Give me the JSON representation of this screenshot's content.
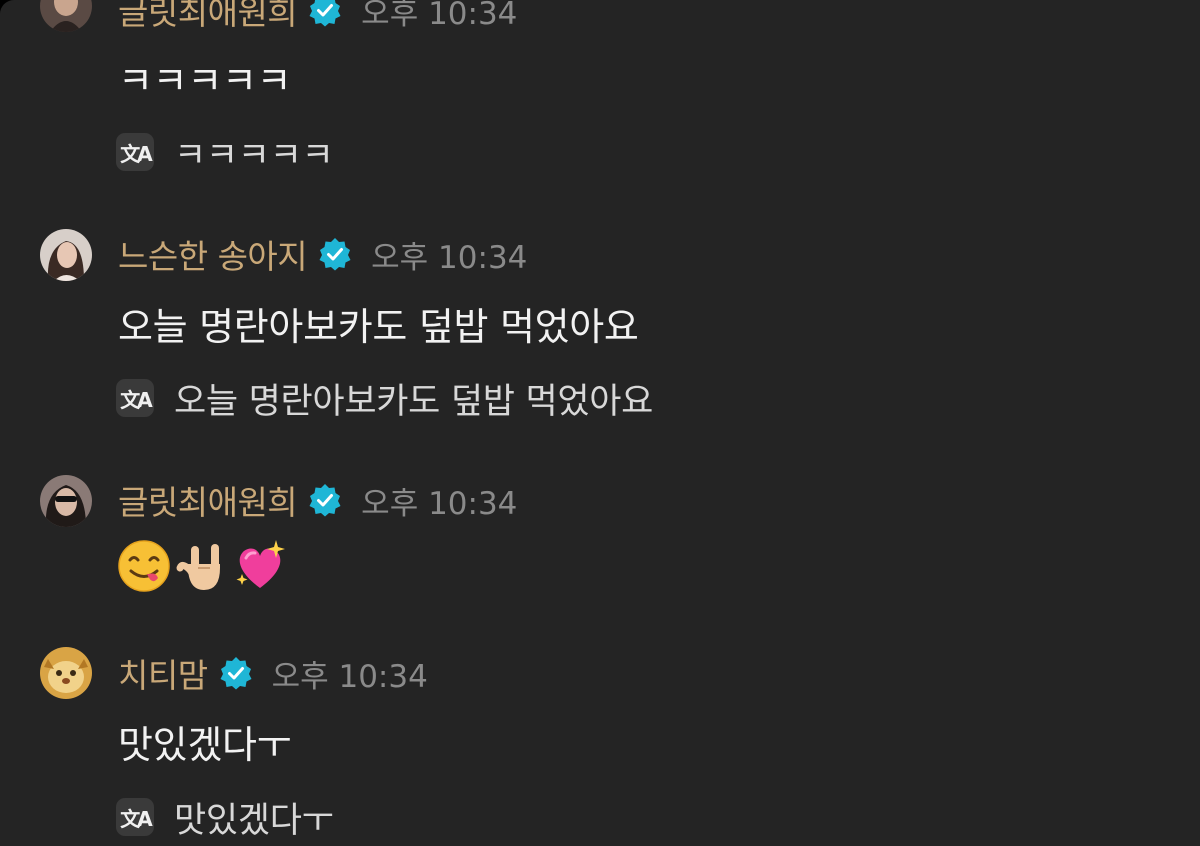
{
  "messages": [
    {
      "username": "글릿최애원희",
      "time": "오후 10:34",
      "text": "ㅋㅋㅋㅋㅋ",
      "translation": "ㅋㅋㅋㅋㅋ"
    },
    {
      "username": "느슨한 송아지",
      "time": "오후 10:34",
      "text": "오늘 명란아보카도 덮밥 먹었아요",
      "translation": "오늘 명란아보카도 덮밥 먹었아요"
    },
    {
      "username": "글릿최애원희",
      "time": "오후 10:34",
      "emojis": [
        "yum-face-emoji",
        "rock-on-hand-emoji",
        "sparkling-heart-emoji"
      ]
    },
    {
      "username": "치티맘",
      "time": "오후 10:34",
      "text": "맛있겠다ㅜ",
      "translation": "맛있겠다ㅜ"
    }
  ],
  "translate_icon_label": "文A",
  "colors": {
    "background": "#242424",
    "username": "#c9a878",
    "timestamp": "#8a8a8a",
    "verified_badge": "#1fb6d6",
    "message_text": "#f2f2f2"
  }
}
